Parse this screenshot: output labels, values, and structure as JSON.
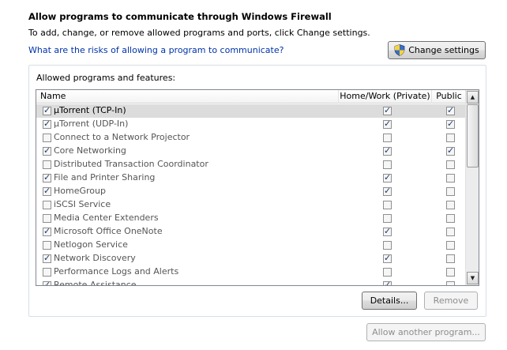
{
  "header": {
    "title": "Allow programs to communicate through Windows Firewall",
    "description": "To add, change, or remove allowed programs and ports, click Change settings.",
    "risk_link": "What are the risks of allowing a program to communicate?",
    "change_settings": "Change settings",
    "shield_icon": "uac-shield-icon"
  },
  "group": {
    "label": "Allowed programs and features:",
    "columns": [
      "Name",
      "Home/Work (Private)",
      "Public"
    ],
    "rows": [
      {
        "name": "µTorrent (TCP-In)",
        "enabled": true,
        "home": true,
        "public": true,
        "selected": true
      },
      {
        "name": "µTorrent (UDP-In)",
        "enabled": true,
        "home": true,
        "public": true,
        "selected": false
      },
      {
        "name": "Connect to a Network Projector",
        "enabled": false,
        "home": false,
        "public": false,
        "selected": false
      },
      {
        "name": "Core Networking",
        "enabled": true,
        "home": true,
        "public": true,
        "selected": false
      },
      {
        "name": "Distributed Transaction Coordinator",
        "enabled": false,
        "home": false,
        "public": false,
        "selected": false
      },
      {
        "name": "File and Printer Sharing",
        "enabled": true,
        "home": true,
        "public": false,
        "selected": false
      },
      {
        "name": "HomeGroup",
        "enabled": true,
        "home": true,
        "public": false,
        "selected": false
      },
      {
        "name": "iSCSI Service",
        "enabled": false,
        "home": false,
        "public": false,
        "selected": false
      },
      {
        "name": "Media Center Extenders",
        "enabled": false,
        "home": false,
        "public": false,
        "selected": false
      },
      {
        "name": "Microsoft Office OneNote",
        "enabled": true,
        "home": true,
        "public": false,
        "selected": false
      },
      {
        "name": "Netlogon Service",
        "enabled": false,
        "home": false,
        "public": false,
        "selected": false
      },
      {
        "name": "Network Discovery",
        "enabled": true,
        "home": true,
        "public": false,
        "selected": false
      },
      {
        "name": "Performance Logs and Alerts",
        "enabled": false,
        "home": false,
        "public": false,
        "selected": false
      },
      {
        "name": "Remote Assistance",
        "enabled": true,
        "home": true,
        "public": false,
        "selected": false
      }
    ],
    "details": "Details...",
    "remove": "Remove"
  },
  "allow_another": "Allow another program..."
}
